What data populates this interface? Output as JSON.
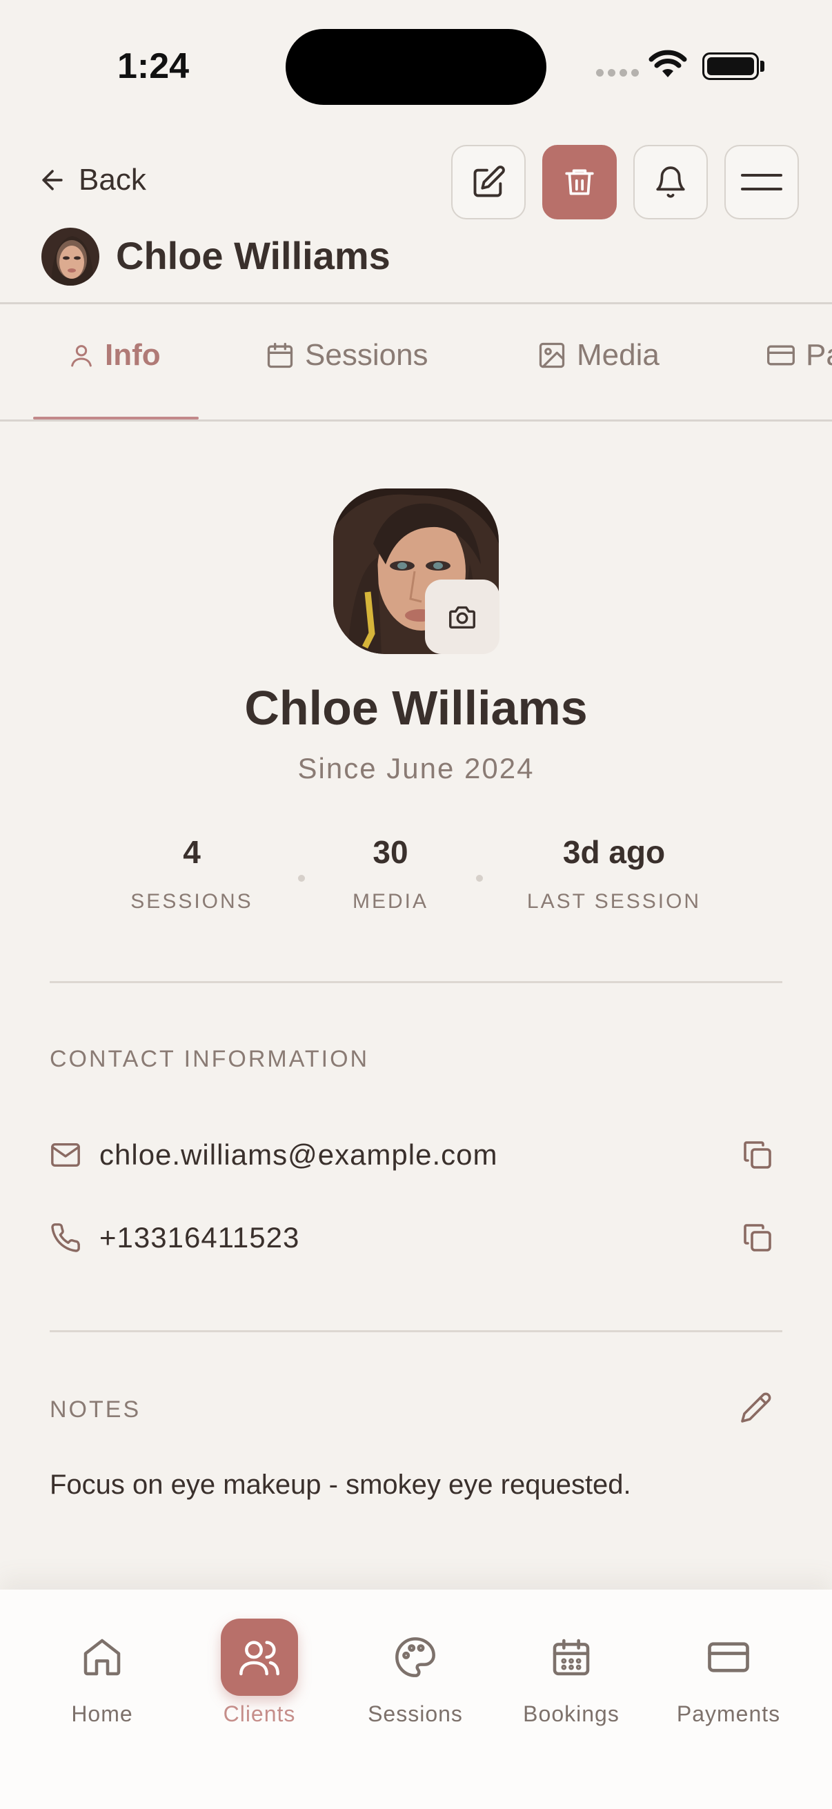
{
  "status_bar": {
    "time": "1:24"
  },
  "header": {
    "back_label": "Back",
    "client_name": "Chloe Williams",
    "delete_color": "#b8706a"
  },
  "tabs": [
    {
      "label": "Info",
      "icon": "user-icon",
      "active": true
    },
    {
      "label": "Sessions",
      "icon": "calendar-icon"
    },
    {
      "label": "Media",
      "icon": "image-icon"
    },
    {
      "label": "Pa",
      "icon": "card-icon"
    }
  ],
  "profile": {
    "name": "Chloe Williams",
    "since": "Since June 2024"
  },
  "stats": [
    {
      "value": "4",
      "label": "SESSIONS"
    },
    {
      "value": "30",
      "label": "MEDIA"
    },
    {
      "value": "3d ago",
      "label": "LAST SESSION"
    }
  ],
  "contact": {
    "title": "CONTACT INFORMATION",
    "email": "chloe.williams@example.com",
    "phone": "+13316411523"
  },
  "notes": {
    "title": "NOTES",
    "text": "Focus on eye makeup - smokey eye requested."
  },
  "bottom_nav": [
    {
      "label": "Home",
      "icon": "home-icon"
    },
    {
      "label": "Clients",
      "icon": "clients-icon",
      "active": true
    },
    {
      "label": "Sessions",
      "icon": "palette-icon"
    },
    {
      "label": "Bookings",
      "icon": "calendar-grid-icon"
    },
    {
      "label": "Payments",
      "icon": "card-icon"
    }
  ],
  "colors": {
    "accent": "#b8706a",
    "background": "#f5f2ee",
    "text": "#3a302c",
    "muted": "#8a7b74"
  }
}
